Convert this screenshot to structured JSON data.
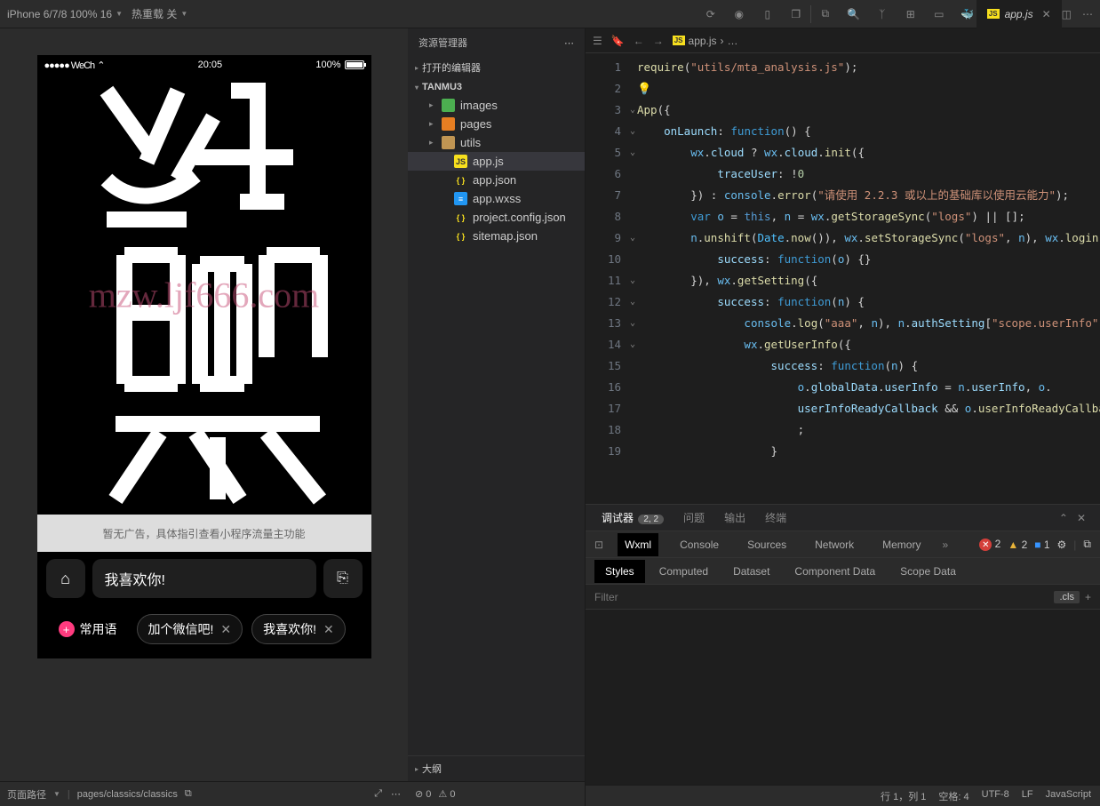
{
  "topbar": {
    "device": "iPhone 6/7/8 100% 16",
    "reload": "热重载 关"
  },
  "tab": {
    "name": "app.js"
  },
  "explorer": {
    "title": "资源管理器",
    "open_editors": "打开的编辑器",
    "project": "TANMU3",
    "outline": "大纲",
    "items": [
      {
        "label": "images",
        "icon": "ic-folder green",
        "depth": "d1",
        "folder": true
      },
      {
        "label": "pages",
        "icon": "ic-folder orange",
        "depth": "d1",
        "folder": true
      },
      {
        "label": "utils",
        "icon": "ic-folder",
        "depth": "d1",
        "folder": true
      },
      {
        "label": "app.js",
        "icon": "ic-js",
        "iconText": "JS",
        "depth": "d2",
        "active": true
      },
      {
        "label": "app.json",
        "icon": "ic-json",
        "iconText": "{ }",
        "depth": "d2"
      },
      {
        "label": "app.wxss",
        "icon": "ic-wxss",
        "iconText": "≡",
        "depth": "d2"
      },
      {
        "label": "project.config.json",
        "icon": "ic-json",
        "iconText": "{ }",
        "depth": "d2"
      },
      {
        "label": "sitemap.json",
        "icon": "ic-json",
        "iconText": "{ }",
        "depth": "d2"
      }
    ]
  },
  "breadcrumb": {
    "file": "app.js",
    "sep": "›",
    "more": "…"
  },
  "code": {
    "lines": [
      1,
      2,
      3,
      4,
      5,
      6,
      7,
      8,
      9,
      10,
      11,
      12,
      13,
      14,
      15,
      16,
      17,
      18,
      19
    ]
  },
  "sim": {
    "carrier": "●●●●● WeCh",
    "time": "20:05",
    "battery": "100%",
    "watermark": "mzw.ljf666.com",
    "ad": "暂无广告，具体指引查看小程序流量主功能",
    "input": "我喜欢你!",
    "chips": [
      {
        "label": "常用语",
        "primary": true
      },
      {
        "label": "加个微信吧!"
      },
      {
        "label": "我喜欢你!"
      }
    ]
  },
  "simfooter": {
    "path_label": "页面路径",
    "path": "pages/classics/classics"
  },
  "debug": {
    "tabs": [
      "调试器",
      "问题",
      "输出",
      "终端"
    ],
    "badge": "2, 2",
    "sub": [
      "Wxml",
      "Console",
      "Sources",
      "Network",
      "Memory"
    ],
    "styles_tabs": [
      "Styles",
      "Computed",
      "Dataset",
      "Component Data",
      "Scope Data"
    ],
    "filter": "Filter",
    "cls": ".cls",
    "err": "2",
    "warn": "2",
    "info": "1"
  },
  "status": {
    "err": "0",
    "warn": "0",
    "pos": "行 1，列 1",
    "spaces": "空格: 4",
    "enc": "UTF-8",
    "eol": "LF",
    "lang": "JavaScript"
  }
}
